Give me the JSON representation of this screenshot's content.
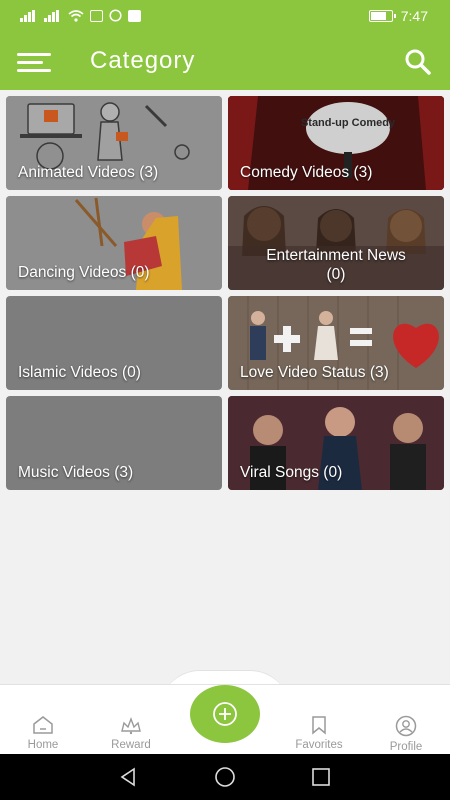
{
  "status_bar": {
    "time": "7:47"
  },
  "header": {
    "title": "Category"
  },
  "categories": [
    {
      "label": "Animated Videos (3)"
    },
    {
      "label": "Comedy Videos (3)",
      "art_text": "Stand-up Comedy"
    },
    {
      "label": "Dancing Videos  (0)"
    },
    {
      "label_line1": "Entertainment News",
      "label_line2": "(0)"
    },
    {
      "label": "Islamic Videos (0)"
    },
    {
      "label": "Love Video Status (3)"
    },
    {
      "label": "Music Videos (3)"
    },
    {
      "label": "Viral Songs (0)"
    }
  ],
  "bottom_nav": {
    "home": "Home",
    "reward": "Reward",
    "favorites": "Favorites",
    "profile": "Profile"
  },
  "colors": {
    "accent": "#8cc63f",
    "tile_gray": "#7d7d7d",
    "background": "#f1f1f1"
  },
  "icons": [
    "menu-icon",
    "search-icon",
    "home-icon",
    "reward-icon",
    "add-icon",
    "bookmark-icon",
    "profile-icon",
    "back-icon",
    "home-circle-icon",
    "recents-icon"
  ]
}
